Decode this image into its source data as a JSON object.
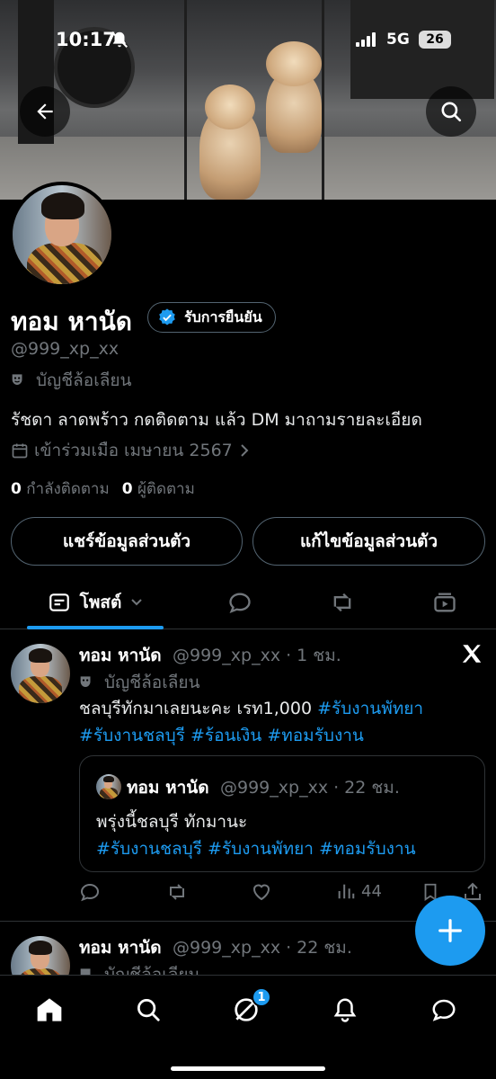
{
  "status_bar": {
    "time": "10:17",
    "network": "5G",
    "battery": "26"
  },
  "profile": {
    "name": "ทอม หานัด",
    "verify_label": "รับการยืนยัน",
    "handle": "@999_xp_xx",
    "parody_label": "บัญชีล้อเลียน",
    "bio": "รัชดา ลาดพร้าว กดติดตาม แล้ว DM มาถามรายละเอียด",
    "joined": "เข้าร่วมเมือ เมษายน 2567",
    "following_count": "0",
    "following_label": "กำลังติดตาม",
    "followers_count": "0",
    "followers_label": "ผู้ติดตาม",
    "share_button": "แชร์ข้อมูลส่วนตัว",
    "edit_button": "แก้ไขข้อมูลส่วนตัว"
  },
  "tabs": {
    "posts_label": "โพสต์"
  },
  "post1": {
    "name": "ทอม หานัด",
    "meta": "@999_xp_xx · 1 ชม.",
    "parody_label": "บัญชีล้อเลียน",
    "text_line1": "ชลบุรีทักมาเลยนะคะ เรท1,000 ",
    "tag1": "#รับงานพัทยา",
    "tag2": "#รับงานชลบุรี",
    "tag3": "#ร้อนเงิน",
    "tag4": "#ทอมรับงาน",
    "quote": {
      "name": "ทอม หานัด",
      "meta": "@999_xp_xx · 22 ชม.",
      "text": "พรุ่งนี้ชลบุรี ทักมานะ",
      "tag1": "#รับงานชลบุรี",
      "tag2": "#รับงานพัทยา",
      "tag3": "#ทอมรับงาน"
    },
    "views": "44"
  },
  "post2": {
    "name": "ทอม หานัด",
    "meta": "@999_xp_xx · 22 ชม.",
    "parody_label": "บัญชีล้อเลียน"
  },
  "nav": {
    "notifications_badge": "1"
  },
  "colors": {
    "accent": "#1d9bf0",
    "muted": "#71767b",
    "border": "#2f3336"
  }
}
